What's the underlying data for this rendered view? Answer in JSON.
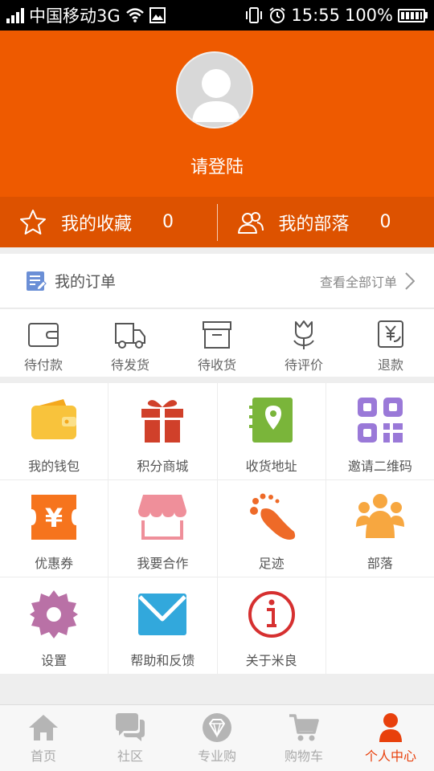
{
  "status_bar": {
    "carrier": "中国移动3G",
    "time": "15:55",
    "battery": "100%"
  },
  "profile": {
    "login_text": "请登陆"
  },
  "quick_bar": {
    "favorites_label": "我的收藏",
    "favorites_count": "0",
    "tribes_label": "我的部落",
    "tribes_count": "0"
  },
  "orders": {
    "title": "我的订单",
    "view_all": "查看全部订单",
    "items": [
      {
        "label": "待付款",
        "icon": "wallet-icon"
      },
      {
        "label": "待发货",
        "icon": "truck-icon"
      },
      {
        "label": "待收货",
        "icon": "box-icon"
      },
      {
        "label": "待评价",
        "icon": "flower-icon"
      },
      {
        "label": "退款",
        "icon": "refund-icon"
      }
    ]
  },
  "grid": [
    {
      "label": "我的钱包",
      "icon": "purse-icon",
      "color": "#f8c33c"
    },
    {
      "label": "积分商城",
      "icon": "gift-icon",
      "color": "#d0402a"
    },
    {
      "label": "收货地址",
      "icon": "address-book-icon",
      "color": "#7ab53a"
    },
    {
      "label": "邀请二维码",
      "icon": "qr-code-icon",
      "color": "#9a79d8"
    },
    {
      "label": "优惠券",
      "icon": "coupon-icon",
      "color": "#f6741d"
    },
    {
      "label": "我要合作",
      "icon": "shop-icon",
      "color": "#ef8f9a"
    },
    {
      "label": "足迹",
      "icon": "footprint-icon",
      "color": "#ee6a28"
    },
    {
      "label": "部落",
      "icon": "group-icon",
      "color": "#f7a740"
    },
    {
      "label": "设置",
      "icon": "settings-gear-icon",
      "color": "#b971a6"
    },
    {
      "label": "帮助和反馈",
      "icon": "mail-icon",
      "color": "#32a8dc"
    },
    {
      "label": "关于米良",
      "icon": "info-icon",
      "color": "#d63030"
    }
  ],
  "tabs": [
    {
      "label": "首页",
      "icon": "home-icon"
    },
    {
      "label": "社区",
      "icon": "chat-icon"
    },
    {
      "label": "专业购",
      "icon": "diamond-icon"
    },
    {
      "label": "购物车",
      "icon": "cart-icon"
    },
    {
      "label": "个人中心",
      "icon": "person-icon",
      "active": true
    }
  ],
  "colors": {
    "brand_orange": "#ee5a00",
    "active_tab": "#e8400c"
  }
}
